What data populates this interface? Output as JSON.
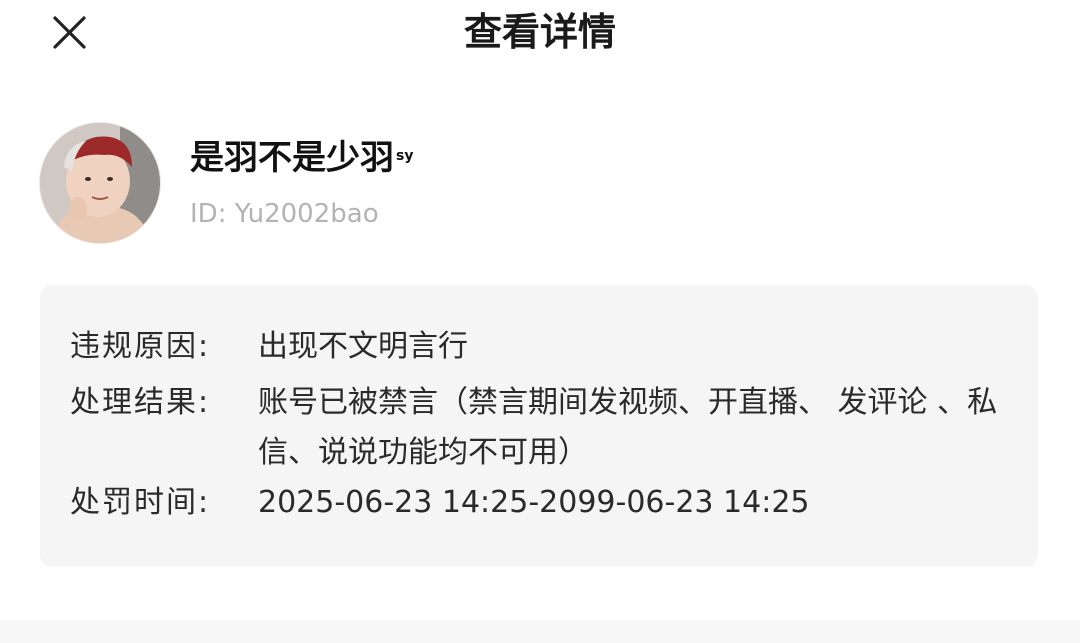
{
  "header": {
    "title": "查看详情",
    "close_icon": "close-icon"
  },
  "profile": {
    "name": "是羽不是少羽",
    "name_suffix": "sy",
    "id_text": "ID: Yu2002bao",
    "avatar_icon": "avatar-image"
  },
  "details": {
    "reason_label": "违规原因:",
    "reason_value": "出现不文明言行",
    "result_label": "处理结果:",
    "result_value": "账号已被禁言（禁言期间发视频、开直播、 发评论 、私信、说说功能均不可用）",
    "time_label": "处罚时间:",
    "time_value": "2025-06-23 14:25-2099-06-23 14:25"
  },
  "colors": {
    "card_background": "#f5f5f5",
    "id_text": "#b3b3b3",
    "title_text": "#1a1a1a"
  }
}
